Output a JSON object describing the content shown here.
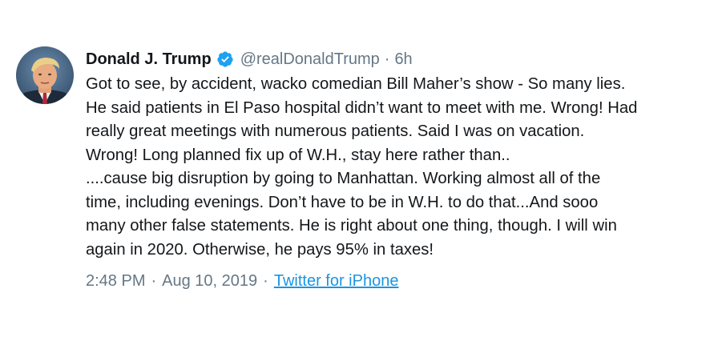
{
  "tweet": {
    "author_name": "Donald J. Trump",
    "verified_icon": "verified-badge-icon",
    "handle": "@realDonaldTrump",
    "separator": "·",
    "time_ago": "6h",
    "lines": [
      "Got to see, by accident, wacko comedian Bill Maher’s show - So many lies.",
      "He said patients in El Paso hospital didn’t want to meet with me. Wrong! Had",
      "really great meetings with numerous patients. Said I was on vacation.",
      "Wrong! Long planned fix up of W.H., stay here rather than..",
      "....cause big disruption by going to Manhattan. Working almost all of the",
      "time, including evenings. Don’t have to be in W.H. to do that...And sooo",
      "many other false statements. He is right about one thing, though. I will win",
      "again in 2020. Otherwise, he pays 95% in taxes!"
    ],
    "footer": {
      "time": "2:48 PM",
      "dot1": "·",
      "date": "Aug 10, 2019",
      "dot2": "·",
      "source": "Twitter for iPhone"
    }
  },
  "colors": {
    "text": "#14171a",
    "secondary": "#657786",
    "link": "#1b95e0",
    "verified": "#1da1f2"
  }
}
